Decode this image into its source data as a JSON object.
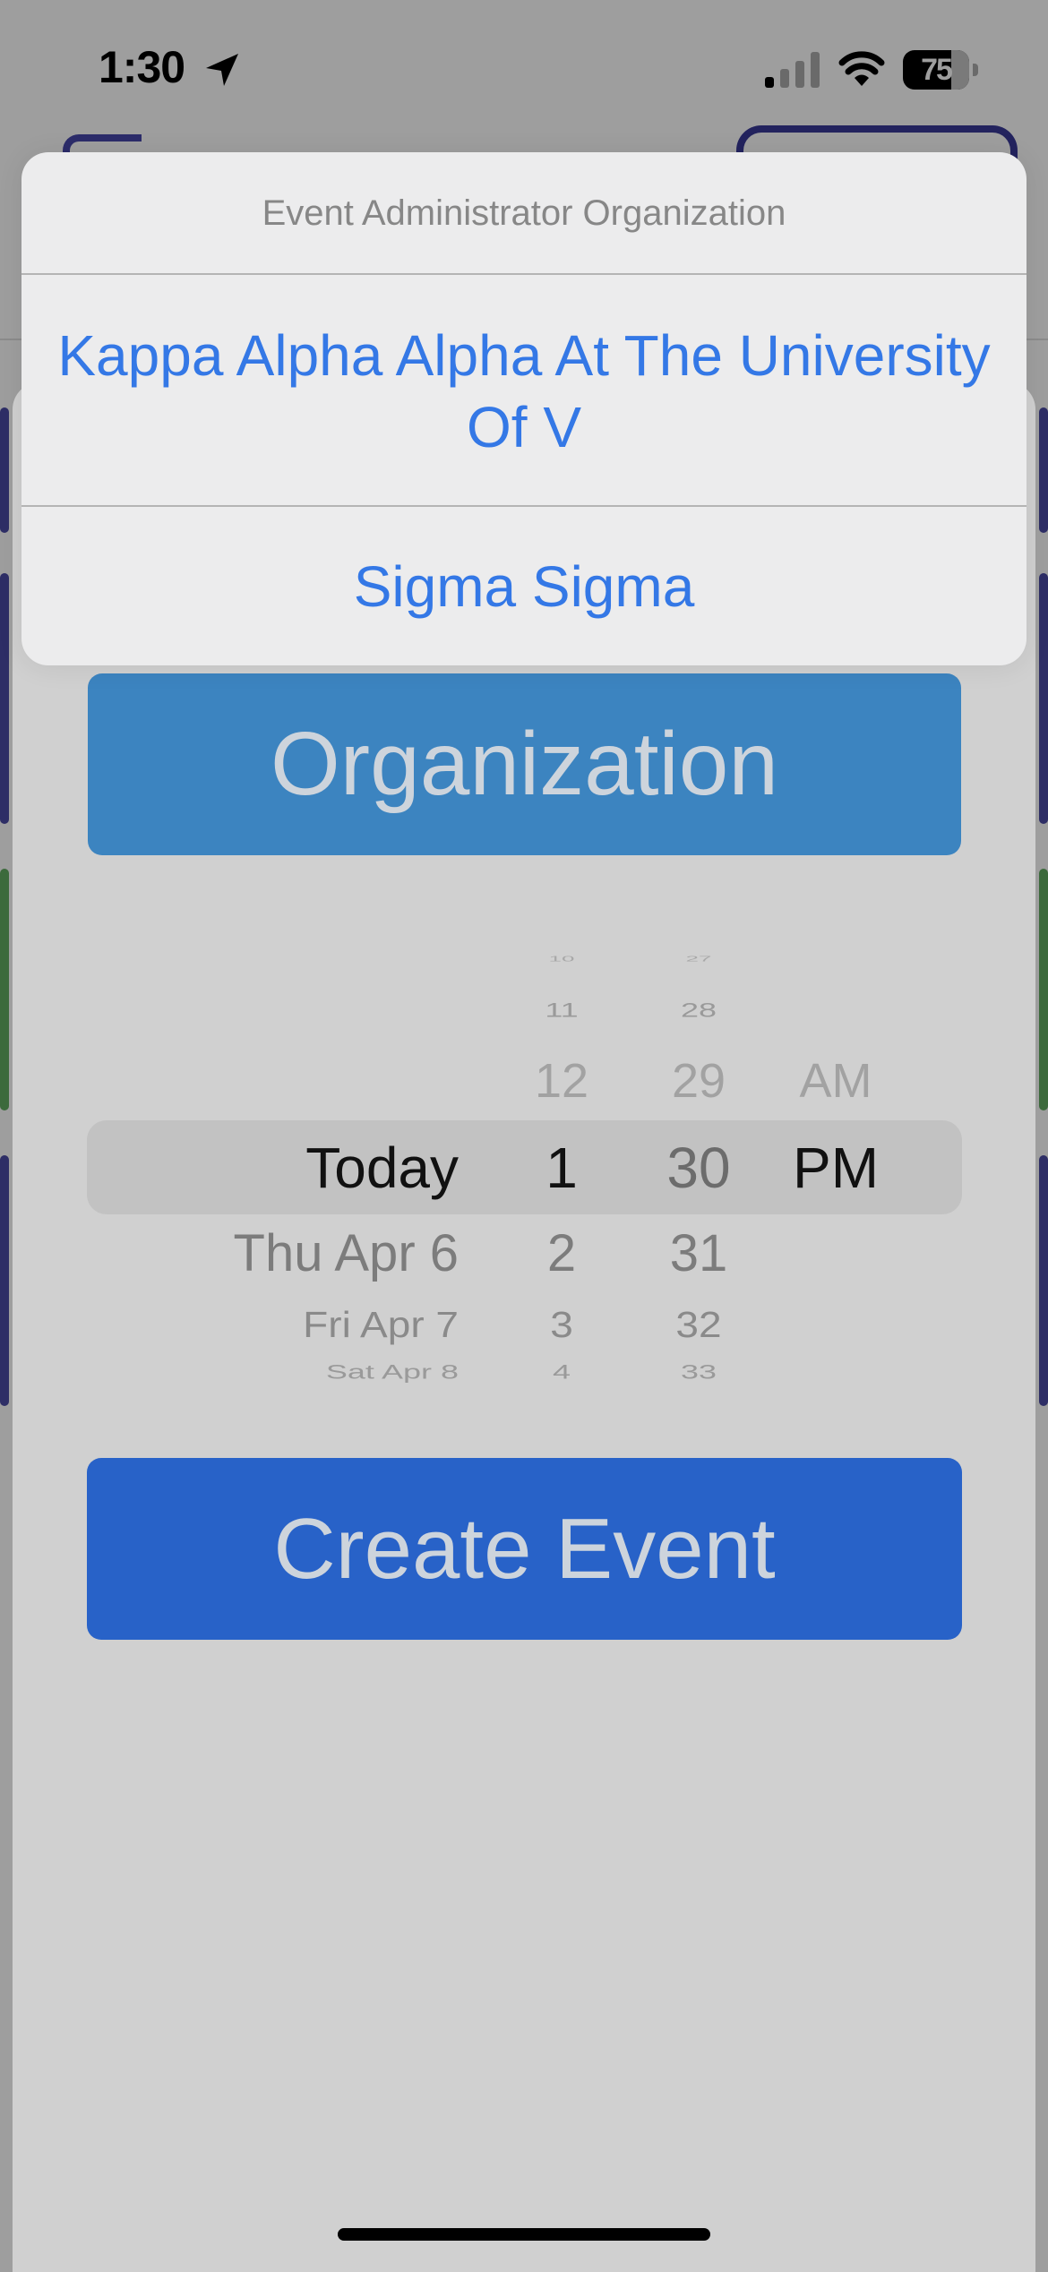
{
  "status_bar": {
    "time": "1:30",
    "battery": "75"
  },
  "action_sheet": {
    "title": "Event Administrator Organization",
    "options": [
      {
        "label": "Kappa Alpha Alpha At The University Of V"
      },
      {
        "label": "Sigma Sigma"
      }
    ]
  },
  "organization_button": {
    "label": "Organization"
  },
  "date_picker": {
    "dates": {
      "selected": "Today",
      "below": [
        "Thu Apr 6",
        "Fri Apr 7",
        "Sat Apr 8"
      ]
    },
    "hours": {
      "above": [
        "10",
        "11",
        "12"
      ],
      "selected": "1",
      "below": [
        "2",
        "3",
        "4"
      ]
    },
    "minutes": {
      "above": [
        "27",
        "28",
        "29"
      ],
      "selected": "30",
      "below": [
        "31",
        "32",
        "33"
      ]
    },
    "ampm": {
      "above": "AM",
      "selected": "PM"
    }
  },
  "create_event_button": {
    "label": "Create Event"
  },
  "colors": {
    "organization_button": "#3c84c0",
    "create_button": "#2862c8",
    "action_text": "#3478e6"
  }
}
